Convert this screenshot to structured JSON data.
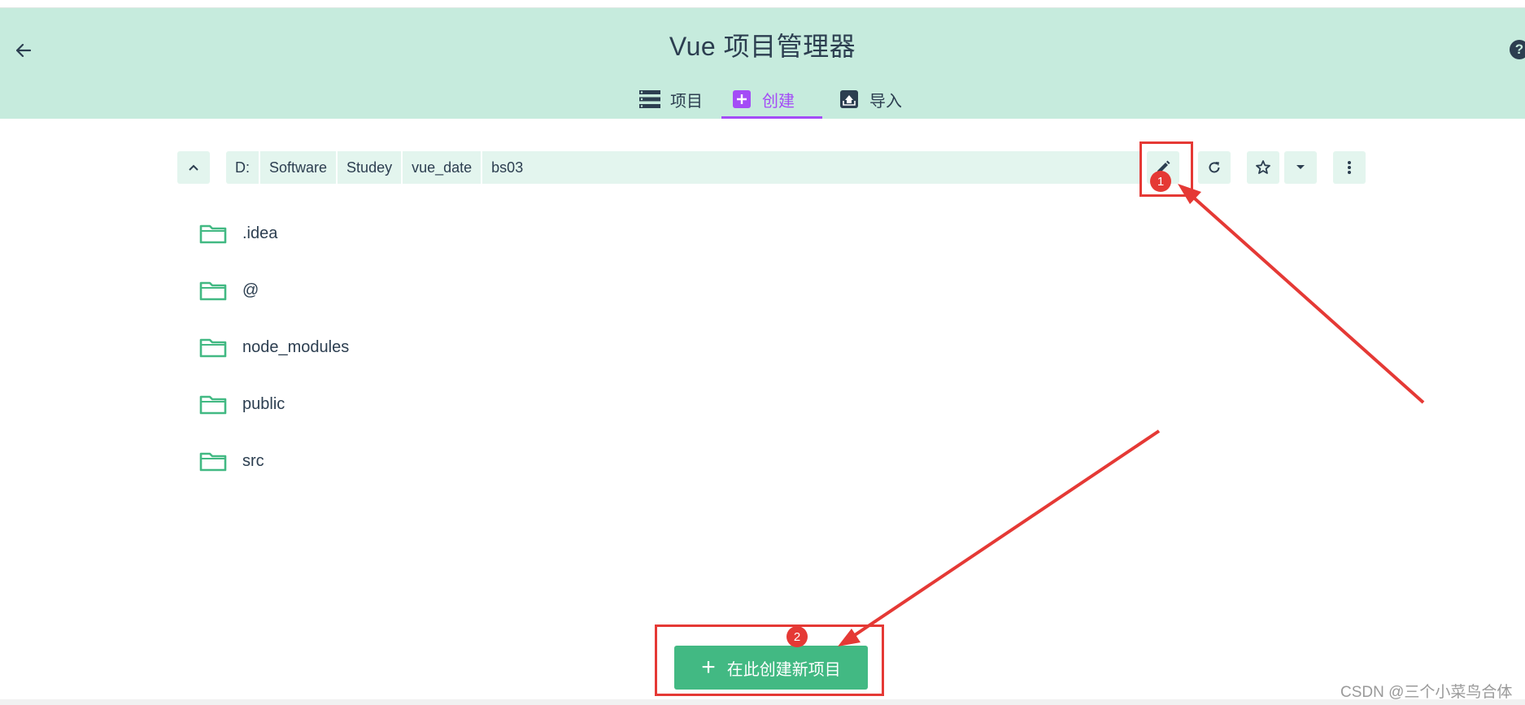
{
  "header": {
    "title": "Vue 项目管理器",
    "back_icon": "arrow-left-icon",
    "help_icon": "help-circle-icon",
    "help_glyph": "?"
  },
  "tabs": [
    {
      "label": "项目",
      "icon": "list-icon",
      "active": false
    },
    {
      "label": "创建",
      "icon": "plus-box-icon",
      "active": true
    },
    {
      "label": "导入",
      "icon": "import-box-icon",
      "active": false
    }
  ],
  "path_bar": {
    "crumbs": [
      "D:",
      "Software",
      "Studey",
      "vue_date",
      "bs03"
    ]
  },
  "folders": [
    ".idea",
    "@",
    "node_modules",
    "public",
    "src"
  ],
  "create_button": {
    "label": "在此创建新项目",
    "plus": "+"
  },
  "annotations": [
    {
      "number": "1"
    },
    {
      "number": "2"
    }
  ],
  "watermark": "CSDN @三个小菜鸟合体",
  "colors": {
    "header_bg": "#c6ebdd",
    "accent": "#a44cf6",
    "primary": "#42b983",
    "annotation": "#e53935",
    "text": "#2c3e50"
  }
}
